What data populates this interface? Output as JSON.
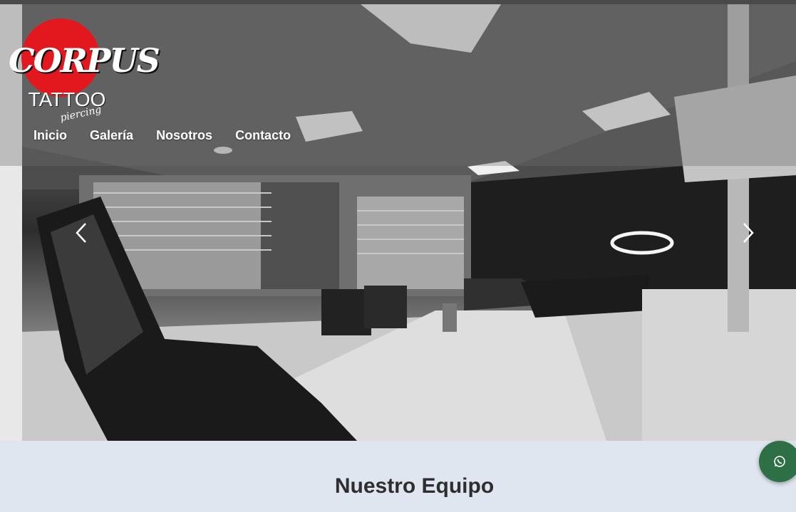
{
  "brand": {
    "name_line1": "CORPUS",
    "name_line2": "TATTOO",
    "name_line3": "piercing",
    "logo_red": "#e3181f"
  },
  "nav": {
    "items": [
      {
        "label": "Inicio"
      },
      {
        "label": "Galería"
      },
      {
        "label": "Nosotros"
      },
      {
        "label": "Contacto"
      }
    ]
  },
  "hero": {
    "image_icon": "tattoo-studio-photo",
    "prev_icon": "chevron-left-icon",
    "next_icon": "chevron-right-icon"
  },
  "team_section": {
    "title": "Nuestro Equipo"
  },
  "floating": {
    "whatsapp_icon": "whatsapp-icon",
    "whatsapp_color": "#2f6f45"
  }
}
